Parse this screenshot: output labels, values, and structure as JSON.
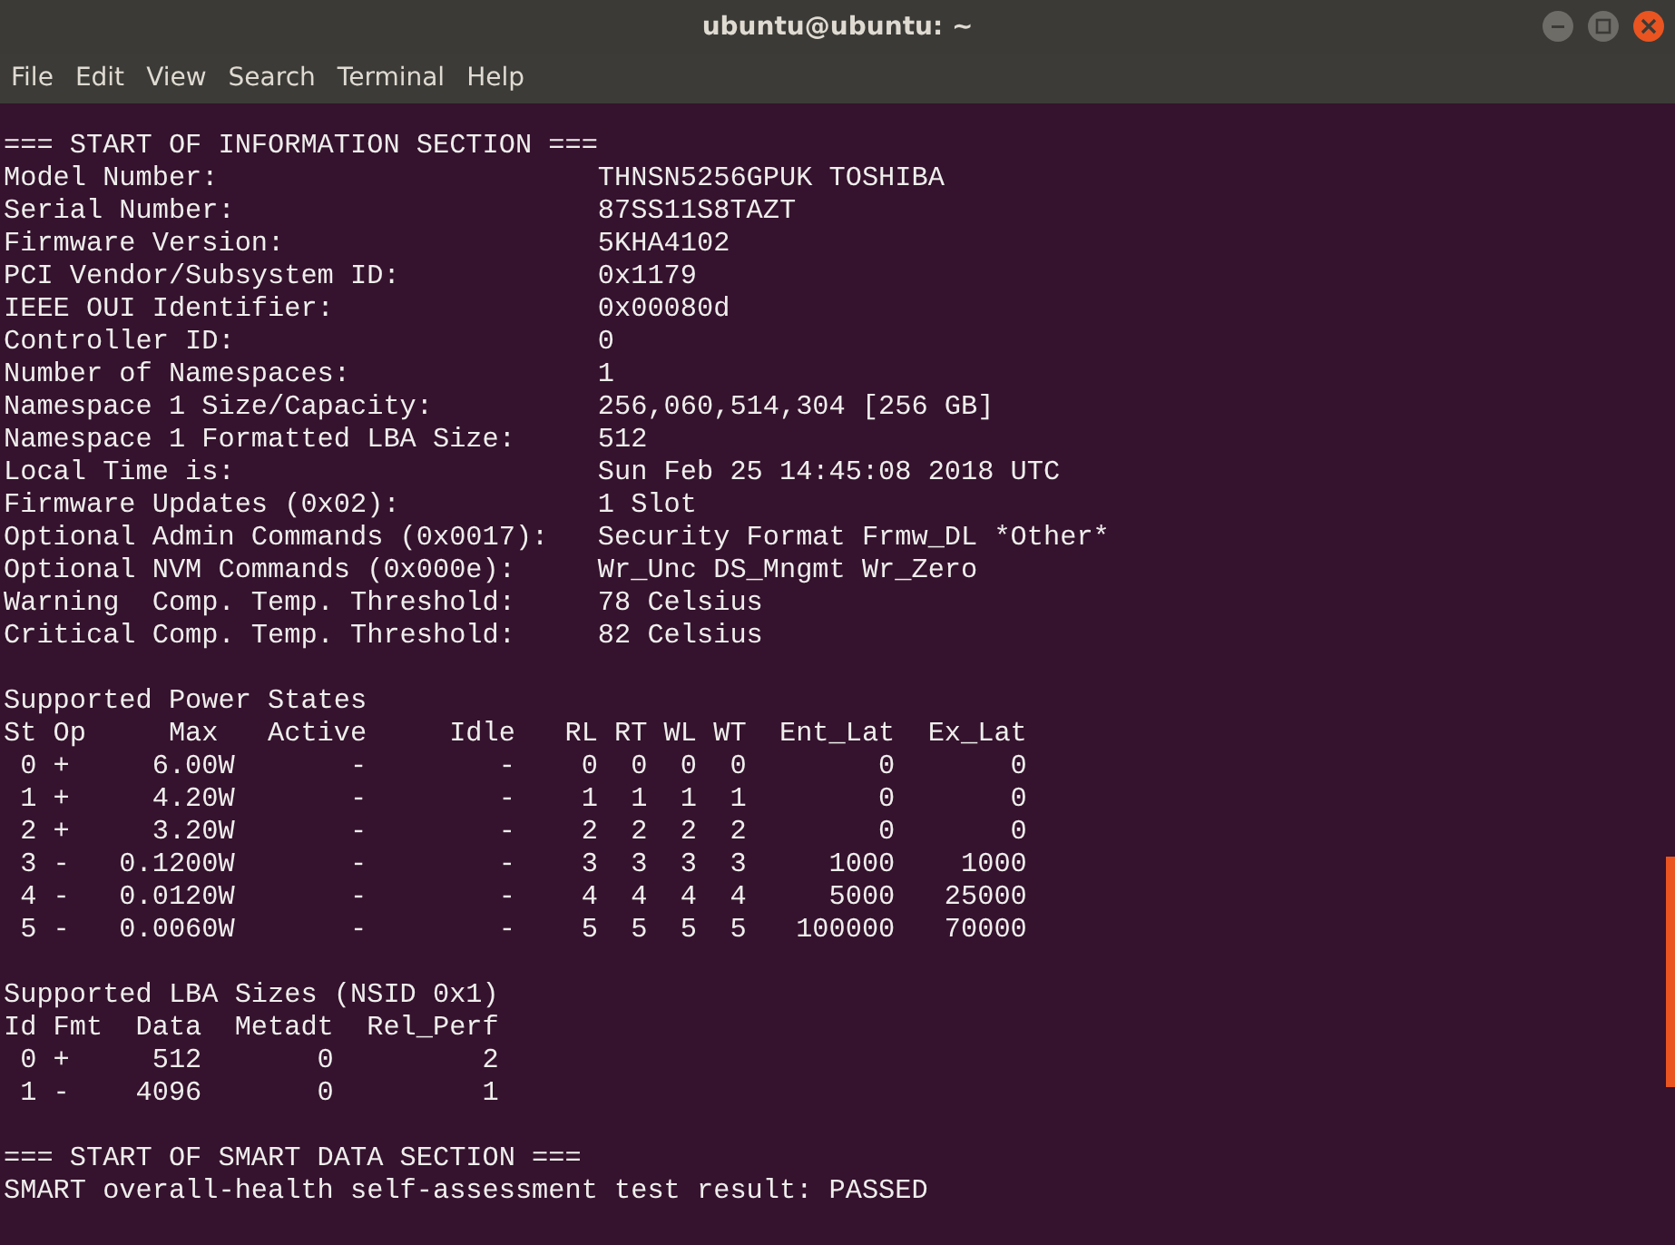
{
  "window": {
    "title": "ubuntu@ubuntu: ~"
  },
  "menu": [
    "File",
    "Edit",
    "View",
    "Search",
    "Terminal",
    "Help"
  ],
  "terminal": {
    "blocks": [
      [
        "=== START OF INFORMATION SECTION ===",
        "Model Number:                       THNSN5256GPUK TOSHIBA",
        "Serial Number:                      87SS11S8TAZT",
        "Firmware Version:                   5KHA4102",
        "PCI Vendor/Subsystem ID:            0x1179",
        "IEEE OUI Identifier:                0x00080d",
        "Controller ID:                      0",
        "Number of Namespaces:               1",
        "Namespace 1 Size/Capacity:          256,060,514,304 [256 GB]",
        "Namespace 1 Formatted LBA Size:     512",
        "Local Time is:                      Sun Feb 25 14:45:08 2018 UTC",
        "Firmware Updates (0x02):            1 Slot",
        "Optional Admin Commands (0x0017):   Security Format Frmw_DL *Other*",
        "Optional NVM Commands (0x000e):     Wr_Unc DS_Mngmt Wr_Zero",
        "Warning  Comp. Temp. Threshold:     78 Celsius",
        "Critical Comp. Temp. Threshold:     82 Celsius"
      ],
      [
        "Supported Power States",
        "St Op     Max   Active     Idle   RL RT WL WT  Ent_Lat  Ex_Lat",
        " 0 +     6.00W       -        -    0  0  0  0        0       0",
        " 1 +     4.20W       -        -    1  1  1  1        0       0",
        " 2 +     3.20W       -        -    2  2  2  2        0       0",
        " 3 -   0.1200W       -        -    3  3  3  3     1000    1000",
        " 4 -   0.0120W       -        -    4  4  4  4     5000   25000",
        " 5 -   0.0060W       -        -    5  5  5  5   100000   70000"
      ],
      [
        "Supported LBA Sizes (NSID 0x1)",
        "Id Fmt  Data  Metadt  Rel_Perf",
        " 0 +     512       0         2",
        " 1 -    4096       0         1"
      ],
      [
        "=== START OF SMART DATA SECTION ===",
        "SMART overall-health self-assessment test result: PASSED"
      ]
    ]
  }
}
